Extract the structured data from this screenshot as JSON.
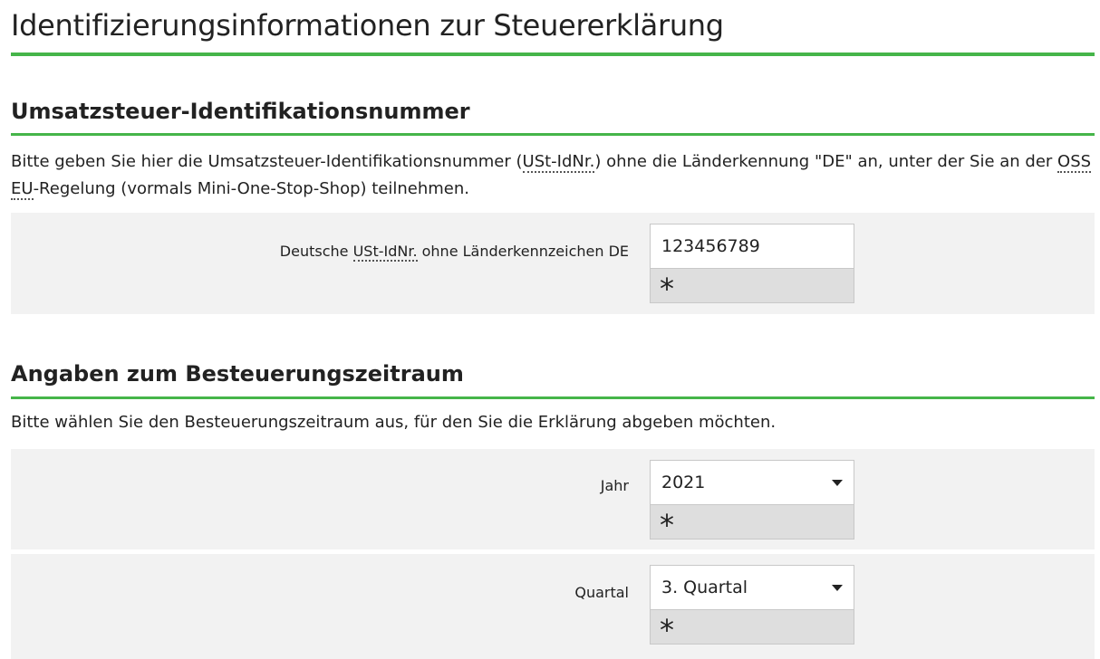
{
  "page": {
    "title": "Identifizierungsinformationen zur Steuererklärung",
    "accent_color": "#45b549"
  },
  "vat_section": {
    "title": "Umsatzsteuer-Identifikationsnummer",
    "intro_before_ust": "Bitte geben Sie hier die Umsatzsteuer-Identifikationsnummer (",
    "ust_abbr": "USt-IdNr.",
    "intro_after_ust": ") ohne die Länderkennung \"DE\" an, unter der Sie an der ",
    "oss_abbr": "OSS",
    "eu_abbr": "EU",
    "intro_end": "-Regelung (vormals Mini-One-Stop-Shop) teilnehmen.",
    "field": {
      "label_before": "Deutsche ",
      "label_abbr": "USt-IdNr.",
      "label_after": " ohne Länderkennzeichen DE",
      "value": "123456789",
      "required_marker": "*"
    }
  },
  "period_section": {
    "title": "Angaben zum Besteuerungszeitraum",
    "intro": "Bitte wählen Sie den Besteuerungszeitraum aus, für den Sie die Erklärung abgeben möchten.",
    "year": {
      "label": "Jahr",
      "selected": "2021",
      "required_marker": "*"
    },
    "quarter": {
      "label": "Quartal",
      "selected": "3. Quartal",
      "required_marker": "*"
    }
  }
}
